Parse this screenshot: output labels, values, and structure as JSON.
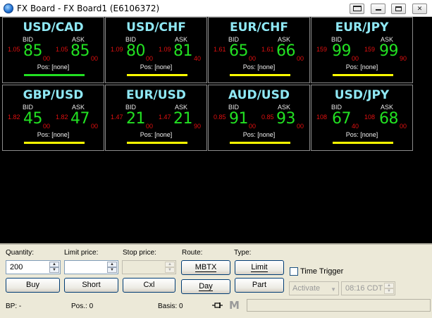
{
  "window": {
    "title": "FX Board - FX Board1 (E6106372)",
    "icons": {
      "app": "globe-icon",
      "layout": "layout-icon",
      "minimize": "minimize-icon",
      "maximize": "maximize-icon",
      "close": "close-icon"
    }
  },
  "board": {
    "labels": {
      "bid": "BID",
      "ask": "ASK"
    },
    "colors": {
      "pair": "#8fe8f4",
      "big": "#22e022",
      "small": "#e01010",
      "green_bar": "#22e022",
      "yellow_bar": "#ffff00"
    },
    "tiles": [
      {
        "pair": "USD/CAD",
        "bid_pre": "1.05",
        "bid_big": "85",
        "bid_frac": "00",
        "ask_pre": "1.05",
        "ask_big": "85",
        "ask_frac": "00",
        "pos": "Pos: [none]",
        "bar_color": "#22e022"
      },
      {
        "pair": "USD/CHF",
        "bid_pre": "1.09",
        "bid_big": "80",
        "bid_frac": "00",
        "ask_pre": "1.09",
        "ask_big": "81",
        "ask_frac": "40",
        "pos": "Pos: [none]",
        "bar_color": "#ffff00"
      },
      {
        "pair": "EUR/CHF",
        "bid_pre": "1.61",
        "bid_big": "65",
        "bid_frac": "00",
        "ask_pre": "1.61",
        "ask_big": "66",
        "ask_frac": "00",
        "pos": "Pos: [none]",
        "bar_color": "#ffff00"
      },
      {
        "pair": "EUR/JPY",
        "bid_pre": "159",
        "bid_big": "99",
        "bid_frac": "00",
        "ask_pre": "159",
        "ask_big": "99",
        "ask_frac": "90",
        "pos": "Pos: [none]",
        "bar_color": "#ffff00"
      },
      {
        "pair": "GBP/USD",
        "bid_pre": "1.82",
        "bid_big": "45",
        "bid_frac": "00",
        "ask_pre": "1.82",
        "ask_big": "47",
        "ask_frac": "00",
        "pos": "Pos: [none]",
        "bar_color": "#ffff00"
      },
      {
        "pair": "EUR/USD",
        "bid_pre": "1.47",
        "bid_big": "21",
        "bid_frac": "00",
        "ask_pre": "1.47",
        "ask_big": "21",
        "ask_frac": "90",
        "pos": "Pos: [none]",
        "bar_color": "#ffff00"
      },
      {
        "pair": "AUD/USD",
        "bid_pre": "0.85",
        "bid_big": "91",
        "bid_frac": "00",
        "ask_pre": "0.85",
        "ask_big": "93",
        "ask_frac": "00",
        "pos": "Pos: [none]",
        "bar_color": "#ffff00"
      },
      {
        "pair": "USD/JPY",
        "bid_pre": "108",
        "bid_big": "67",
        "bid_frac": "40",
        "ask_pre": "108",
        "ask_big": "68",
        "ask_frac": "00",
        "pos": "Pos: [none]",
        "bar_color": "#ffff00"
      }
    ]
  },
  "panel": {
    "quantity_label": "Quantity:",
    "quantity_value": "200",
    "limit_label": "Limit price:",
    "limit_value": "",
    "stop_label": "Stop price:",
    "stop_value": "",
    "route_label": "Route:",
    "route_value": "MBTX",
    "type_label": "Type:",
    "type_value": "Limit",
    "time_trigger_label": "Time Trigger",
    "time_trigger_checked": false,
    "buy_label": "Buy",
    "short_label": "Short",
    "cxl_label": "Cxl",
    "duration_value": "Day",
    "part_label": "Part",
    "activate_value": "Activate",
    "time_value": "08:16 CDT",
    "bp_label": "BP: -",
    "pos_label": "Pos.: 0",
    "basis_label": "Basis: 0",
    "m_label": "M",
    "icons": {
      "pin": "pin-icon",
      "spin_up": "spin-up-icon",
      "spin_down": "spin-down-icon",
      "dropdown": "chevron-down-icon"
    }
  }
}
